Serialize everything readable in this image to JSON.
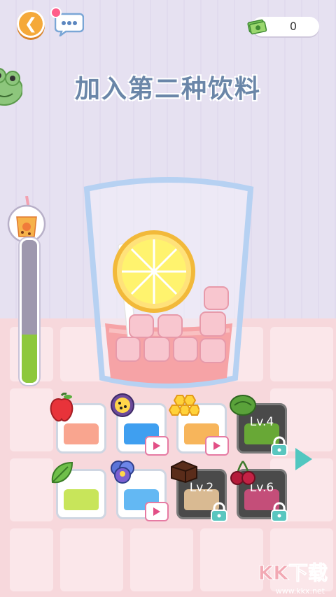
{
  "header": {
    "money": "0"
  },
  "title": "加入第二种饮料",
  "progress": {
    "fill_fraction": 0.34
  },
  "drinks": [
    {
      "row": 1,
      "col": 1,
      "fruit": "apple",
      "color": "#f9a58f",
      "locked": false,
      "ad": false,
      "level": ""
    },
    {
      "row": 1,
      "col": 2,
      "fruit": "passion-fruit",
      "color": "#3f9ff0",
      "locked": false,
      "ad": true,
      "level": ""
    },
    {
      "row": 1,
      "col": 3,
      "fruit": "honey",
      "color": "#f7b55b",
      "locked": false,
      "ad": true,
      "level": ""
    },
    {
      "row": 1,
      "col": 4,
      "fruit": "grape",
      "color": "#6cb234",
      "locked": true,
      "ad": false,
      "level": "Lv.4"
    },
    {
      "row": 2,
      "col": 1,
      "fruit": "mint",
      "color": "#c8e55a",
      "locked": false,
      "ad": false,
      "level": ""
    },
    {
      "row": 2,
      "col": 2,
      "fruit": "butterfly-pea",
      "color": "#63b8f3",
      "locked": false,
      "ad": true,
      "level": ""
    },
    {
      "row": 2,
      "col": 3,
      "fruit": "chocolate",
      "color": "#e9c79a",
      "locked": true,
      "ad": false,
      "level": "Lv.2"
    },
    {
      "row": 2,
      "col": 4,
      "fruit": "cherry",
      "color": "#d14f7e",
      "locked": true,
      "ad": false,
      "level": "Lv.6"
    }
  ],
  "watermark": {
    "brand": "KK下载",
    "site": "www.kkx.net"
  },
  "colors": {
    "accent": "#f5a93a",
    "title": "#6a86a8",
    "meter": "#8dc83c",
    "next": "#51c7c0"
  }
}
